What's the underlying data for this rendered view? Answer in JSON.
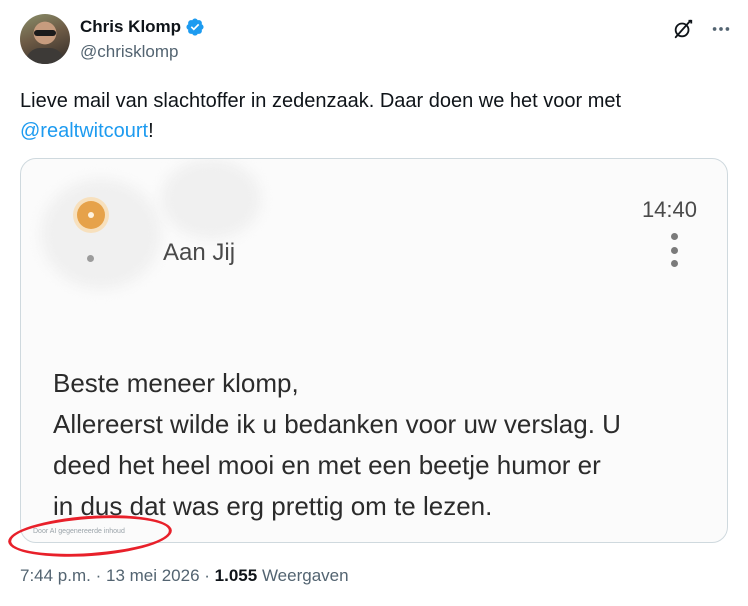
{
  "author": {
    "display_name": "Chris Klomp",
    "handle": "@chrisklomp",
    "verified": true
  },
  "tweet": {
    "text": "Lieve mail van slachtoffer in zedenzaak. Daar doen we het voor met ",
    "mention": "@realtwitcourt",
    "suffix": "!"
  },
  "media": {
    "time": "14:40",
    "recipient": "Aan Jij",
    "body_lines": [
      "Beste meneer klomp,",
      "Allereerst wilde ik u bedanken voor uw verslag. U",
      "deed het heel mooi en met een beetje humor er",
      "in dus dat was erg prettig om te lezen."
    ],
    "ai_label": "Door AI gegenereerde inhoud"
  },
  "meta": {
    "time": "7:44 p.m.",
    "sep1": " · ",
    "date": "13 mei 2026",
    "sep2": " · ",
    "views_count": "1.055",
    "views_label": " Weergaven"
  },
  "colors": {
    "accent": "#1d9bf0",
    "annotation": "#e8202a"
  },
  "icons": [
    "verified-badge-icon",
    "grok-icon",
    "more-icon"
  ]
}
